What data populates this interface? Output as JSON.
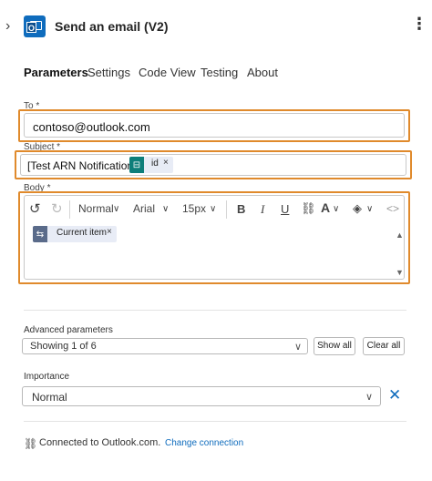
{
  "header": {
    "title": "Send an email (V2)",
    "app_icon_letter": "O"
  },
  "tabs": [
    {
      "label": "Parameters",
      "active": true
    },
    {
      "label": "Settings",
      "active": false
    },
    {
      "label": "Code View",
      "active": false
    },
    {
      "label": "Testing",
      "active": false
    },
    {
      "label": "About",
      "active": false
    }
  ],
  "fields": {
    "to": {
      "label": "To *",
      "value": "contoso@outlook.com"
    },
    "subject": {
      "label": "Subject *",
      "text": "[Test ARN Notification]",
      "token": {
        "label": "id",
        "remove": "×"
      }
    },
    "body": {
      "label": "Body *",
      "token": {
        "label": "Current item",
        "remove": "×"
      }
    }
  },
  "toolbar": {
    "undo": "↺",
    "redo": "↻",
    "format": "Normal",
    "font": "Arial",
    "size": "15px",
    "bold": "B",
    "italic": "I",
    "underline": "U",
    "font_color": "A",
    "code": "<>"
  },
  "advanced": {
    "label": "Advanced parameters",
    "value": "Showing 1 of 6",
    "show_all": "Show all",
    "clear_all": "Clear all"
  },
  "importance": {
    "label": "Importance",
    "value": "Normal"
  },
  "connection": {
    "text": "Connected to Outlook.com.",
    "change_link": "Change connection"
  },
  "colors": {
    "accent": "#0f6cbd",
    "highlight_border": "#e08a2c",
    "token_teal": "#0e7e7a",
    "token_slate": "#5a6b8a"
  }
}
